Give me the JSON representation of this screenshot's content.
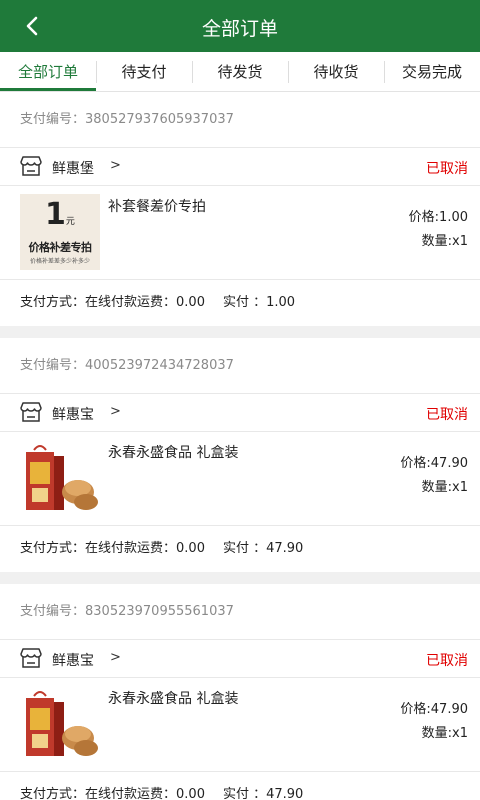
{
  "header": {
    "title": "全部订单",
    "back_icon": "chevron-left-icon"
  },
  "tabs": [
    {
      "label": "全部订单",
      "active": true
    },
    {
      "label": "待支付"
    },
    {
      "label": "待发货"
    },
    {
      "label": "待收货"
    },
    {
      "label": "交易完成"
    }
  ],
  "colors": {
    "primary": "#1f7a3a",
    "status": "#e00000"
  },
  "orders": [
    {
      "pay_id_label": "支付编号：",
      "pay_id": "380527937605937037",
      "shop_name": "鲜惠堡",
      "shop_arrow": ">",
      "status": "已取消",
      "item_name": "补套餐差价专拍",
      "price": "价格:1.00",
      "qty": "数量:x1",
      "thumb": {
        "big": "1",
        "unit": "元",
        "caption": "价格补差专拍",
        "small": "价格补差差多少补多少"
      },
      "pay_method": "支付方式：在线付款",
      "shipping": "运费：0.00",
      "paid": "实付 ：1.00"
    },
    {
      "pay_id_label": "支付编号：",
      "pay_id": "400523972434728037",
      "shop_name": "鲜惠宝",
      "shop_arrow": ">",
      "status": "已取消",
      "item_name": "永春永盛食品 礼盒装",
      "price": "价格:47.90",
      "qty": "数量:x1",
      "pay_method": "支付方式：在线付款",
      "shipping": "运费：0.00",
      "paid": "实付 ：47.90"
    },
    {
      "pay_id_label": "支付编号：",
      "pay_id": "830523970955561037",
      "shop_name": "鲜惠宝",
      "shop_arrow": ">",
      "status": "已取消",
      "item_name": "永春永盛食品 礼盒装",
      "price": "价格:47.90",
      "qty": "数量:x1",
      "pay_method": "支付方式：在线付款",
      "shipping": "运费：0.00",
      "paid": "实付 ：47.90"
    }
  ]
}
